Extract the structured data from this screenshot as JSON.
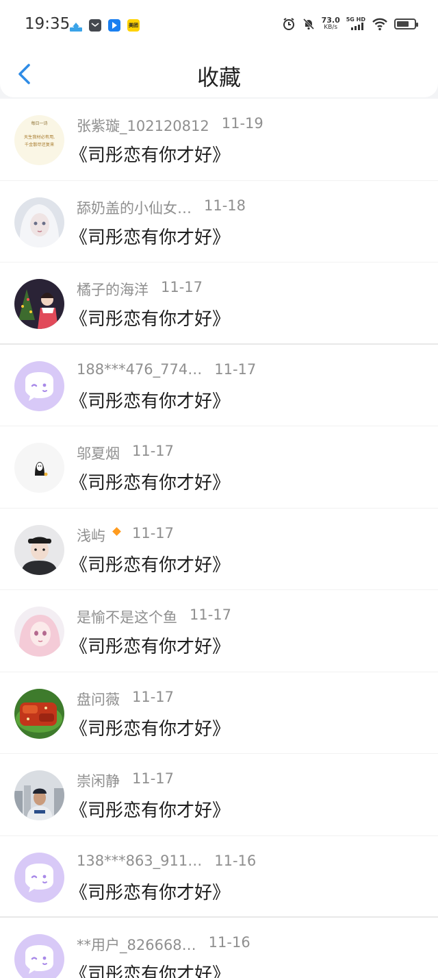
{
  "status_bar": {
    "time": "19:35",
    "speed_value": "73.0",
    "speed_unit": "KB/s",
    "network": "5G HD",
    "app_icons": [
      "home-app-icon",
      "message-app-icon",
      "nav-app-icon",
      "meituan-app-icon"
    ],
    "meituan_label": "美团"
  },
  "nav": {
    "back_icon": "chevron-left-icon",
    "title": "收藏"
  },
  "accent_color": "#2f8ce6",
  "items": [
    {
      "user": "张紫璇_102120812",
      "date": "11-19",
      "title": "《司彤恋有你才好》",
      "avatar_kind": "poem",
      "avatar_text_top": "每日一诗",
      "avatar_text_line1": "天生我材必有用,",
      "avatar_text_line2": "千金散尽还复来"
    },
    {
      "user": "舔奶盖的小仙女…",
      "date": "11-18",
      "title": "《司彤恋有你才好》",
      "avatar_kind": "doll"
    },
    {
      "user": "橘子的海洋",
      "date": "11-17",
      "title": "《司彤恋有你才好》",
      "avatar_kind": "christmas"
    },
    {
      "user": "188***476_774…",
      "date": "11-17",
      "title": "《司彤恋有你才好》",
      "avatar_kind": "default"
    },
    {
      "user": "邬夏烟",
      "date": "11-17",
      "title": "《司彤恋有你才好》",
      "avatar_kind": "noface"
    },
    {
      "user": "浅屿",
      "date": "11-17",
      "title": "《司彤恋有你才好》",
      "avatar_kind": "boys",
      "vip": true
    },
    {
      "user": "是愉不是这个鱼",
      "date": "11-17",
      "title": "《司彤恋有你才好》",
      "avatar_kind": "anime"
    },
    {
      "user": "盘问薇",
      "date": "11-17",
      "title": "《司彤恋有你才好》",
      "avatar_kind": "food"
    },
    {
      "user": "崇闲静",
      "date": "11-17",
      "title": "《司彤恋有你才好》",
      "avatar_kind": "city"
    },
    {
      "user": "138***863_911…",
      "date": "11-16",
      "title": "《司彤恋有你才好》",
      "avatar_kind": "default"
    },
    {
      "user": "**用户_826668…",
      "date": "11-16",
      "title": "《司彤恋有你才好》",
      "avatar_kind": "default"
    }
  ]
}
